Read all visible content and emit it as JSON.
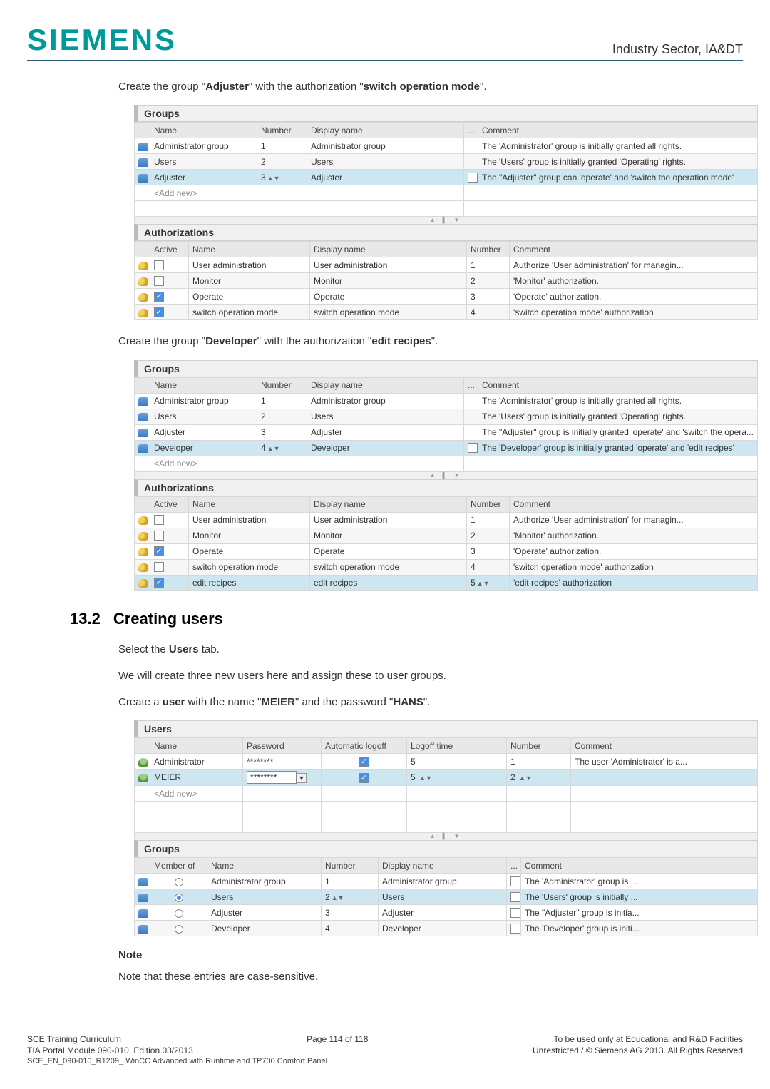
{
  "header": {
    "logo": "SIEMENS",
    "sector": "Industry Sector, IA&DT"
  },
  "intro1_a": "Create the group \"",
  "intro1_b": "\" with the authorization \"",
  "intro1_c": "\".",
  "intro1_group": "Adjuster",
  "intro1_auth": "switch operation mode",
  "shot1": {
    "groups_title": "Groups",
    "head": {
      "name": "Name",
      "number": "Number",
      "display": "Display name",
      "dots": "...",
      "comment": "Comment"
    },
    "rows": [
      {
        "name": "Administrator group",
        "num": "1",
        "disp": "Administrator group",
        "cmt": "The 'Administrator' group is initially granted all rights."
      },
      {
        "name": "Users",
        "num": "2",
        "disp": "Users",
        "cmt": "The 'Users' group is initially granted 'Operating' rights."
      },
      {
        "name": "Adjuster",
        "num": "3",
        "disp": "Adjuster",
        "cmt": "The \"Adjuster\" group can 'operate' and 'switch the operation mode'"
      }
    ],
    "addnew": "<Add new>",
    "auth_title": "Authorizations",
    "auth_head": {
      "active": "Active",
      "name": "Name",
      "display": "Display name",
      "number": "Number",
      "comment": "Comment"
    },
    "auth_rows": [
      {
        "active": false,
        "name": "User administration",
        "disp": "User administration",
        "num": "1",
        "cmt": "Authorize 'User administration' for managin..."
      },
      {
        "active": false,
        "name": "Monitor",
        "disp": "Monitor",
        "num": "2",
        "cmt": "'Monitor' authorization."
      },
      {
        "active": true,
        "name": "Operate",
        "disp": "Operate",
        "num": "3",
        "cmt": "'Operate' authorization."
      },
      {
        "active": true,
        "name": "switch operation mode",
        "disp": "switch operation mode",
        "num": "4",
        "cmt": "'switch operation mode' authorization"
      }
    ]
  },
  "intro2_group": "Developer",
  "intro2_auth": "edit recipes",
  "shot2": {
    "rows": [
      {
        "name": "Administrator group",
        "num": "1",
        "disp": "Administrator group",
        "cmt": "The 'Administrator' group is initially granted all rights."
      },
      {
        "name": "Users",
        "num": "2",
        "disp": "Users",
        "cmt": "The 'Users' group is initially granted 'Operating' rights."
      },
      {
        "name": "Adjuster",
        "num": "3",
        "disp": "Adjuster",
        "cmt": "The \"Adjuster\" group is initially granted 'operate' and 'switch the opera..."
      },
      {
        "name": "Developer",
        "num": "4",
        "disp": "Developer",
        "cmt": "The 'Developer' group is initially granted 'operate' and 'edit recipes'"
      }
    ],
    "auth_rows": [
      {
        "active": false,
        "name": "User administration",
        "disp": "User administration",
        "num": "1",
        "cmt": "Authorize 'User administration' for managin..."
      },
      {
        "active": false,
        "name": "Monitor",
        "disp": "Monitor",
        "num": "2",
        "cmt": "'Monitor' authorization."
      },
      {
        "active": true,
        "name": "Operate",
        "disp": "Operate",
        "num": "3",
        "cmt": "'Operate' authorization."
      },
      {
        "active": false,
        "name": "switch operation mode",
        "disp": "switch operation mode",
        "num": "4",
        "cmt": "'switch operation mode' authorization"
      },
      {
        "active": true,
        "name": "edit recipes",
        "disp": "edit recipes",
        "num": "5",
        "cmt": "'edit recipes' authorization"
      }
    ]
  },
  "section": {
    "num": "13.2",
    "title": "Creating users"
  },
  "p_select_a": "Select the ",
  "p_select_b": " tab.",
  "p_select_bold": "Users",
  "p_three": "We will create three new users here and assign these to user groups.",
  "p_create_a": "Create a ",
  "p_create_user": "user",
  "p_create_b": " with the name \"",
  "p_create_name": "MEIER",
  "p_create_c": "\" and the password \"",
  "p_create_pwd": "HANS",
  "p_create_d": "\".",
  "shot3": {
    "users_title": "Users",
    "uhead": {
      "name": "Name",
      "password": "Password",
      "auto": "Automatic logoff",
      "time": "Logoff time",
      "number": "Number",
      "comment": "Comment"
    },
    "urows": [
      {
        "name": "Administrator",
        "pwd": "********",
        "auto": true,
        "time": "5",
        "num": "1",
        "cmt": "The user 'Administrator' is a..."
      },
      {
        "name": "MEIER",
        "pwd": "********",
        "auto": true,
        "time": "5",
        "num": "2",
        "cmt": ""
      }
    ],
    "addnew": "<Add new>",
    "groups_title": "Groups",
    "ghead": {
      "member": "Member of",
      "name": "Name",
      "number": "Number",
      "display": "Display name",
      "dots": "...",
      "comment": "Comment"
    },
    "grows": [
      {
        "on": false,
        "name": "Administrator group",
        "num": "1",
        "disp": "Administrator group",
        "cmt": "The 'Administrator' group is ..."
      },
      {
        "on": true,
        "name": "Users",
        "num": "2",
        "disp": "Users",
        "cmt": "The 'Users' group is initially ..."
      },
      {
        "on": false,
        "name": "Adjuster",
        "num": "3",
        "disp": "Adjuster",
        "cmt": "The \"Adjuster\" group is initia..."
      },
      {
        "on": false,
        "name": "Developer",
        "num": "4",
        "disp": "Developer",
        "cmt": "The 'Developer' group is initi..."
      }
    ]
  },
  "note_h": "Note",
  "note_p": "Note that these entries are case-sensitive.",
  "footer": {
    "l1": "SCE Training Curriculum",
    "c1": "Page 114 of 118",
    "r1": "To be used only at Educational and R&D Facilities",
    "l2": "TIA Portal Module 090-010, Edition 03/2013",
    "r2": "Unrestricted / © Siemens AG 2013. All Rights Reserved",
    "l3": "SCE_EN_090-010_R1209_ WinCC Advanced with Runtime and TP700 Comfort Panel"
  }
}
